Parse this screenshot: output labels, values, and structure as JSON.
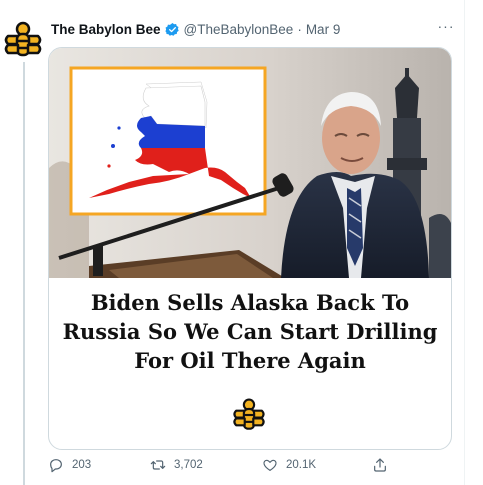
{
  "tweet": {
    "display_name": "The Babylon Bee",
    "handle": "@TheBabylonBee",
    "separator": "·",
    "date": "Mar 9",
    "more_label": "···"
  },
  "card": {
    "headline_lines": [
      "Biden Sells Alaska Back To",
      "Russia So We Can Start Drilling",
      "For Oil There Again"
    ]
  },
  "actions": {
    "replies": "203",
    "retweets": "3,702",
    "likes": "20.1K"
  },
  "colors": {
    "verified_blue": "#1d9bf0",
    "bee_gold": "#f3b321",
    "frame_orange": "#f5a623",
    "russia_blue": "#1c3fd1",
    "russia_red": "#e0201b"
  },
  "icons": [
    "bee-logo-icon",
    "verified-badge-icon",
    "more-icon",
    "reply-icon",
    "retweet-icon",
    "like-icon",
    "share-icon"
  ]
}
